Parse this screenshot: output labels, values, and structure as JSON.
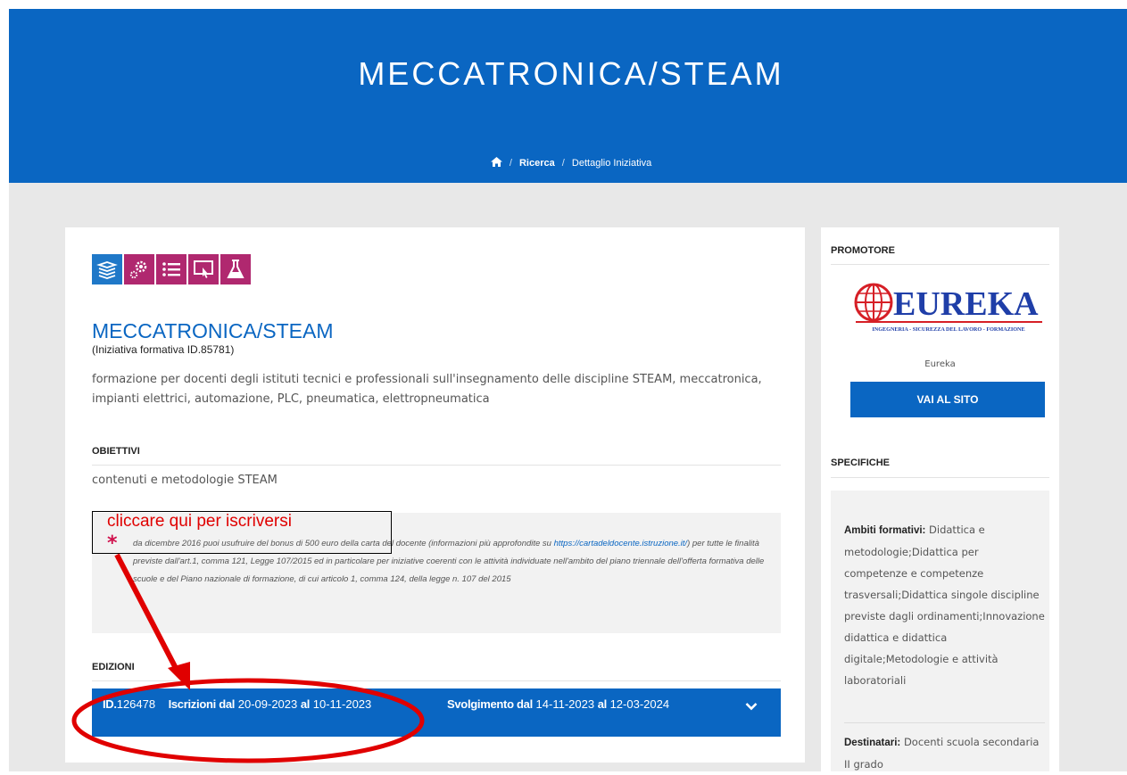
{
  "hero": {
    "title": "MECCATRONICA/STEAM"
  },
  "breadcrumb": {
    "home_icon": "home-icon",
    "separator": "/",
    "items": [
      "Ricerca",
      "Dettaglio Iniziativa"
    ]
  },
  "initiative": {
    "category_icons": [
      {
        "name": "books-icon",
        "color": "#1f78c8"
      },
      {
        "name": "gears-icon",
        "color": "#b0286f"
      },
      {
        "name": "list-icon",
        "color": "#b0286f"
      },
      {
        "name": "touch-screen-icon",
        "color": "#b0286f"
      },
      {
        "name": "flask-icon",
        "color": "#b0286f"
      }
    ],
    "title": "MECCATRONICA/STEAM",
    "subtitle": "(Iniziativa formativa ID.85781)",
    "description": "formazione per docenti degli istituti tecnici e professionali sull'insegnamento delle discipline STEAM, meccatronica, impianti elettrici, automazione, PLC, pneumatica, elettropneumatica",
    "objectives_heading": "OBIETTIVI",
    "objectives": "contenuti e metodologie STEAM",
    "bonus_star": "*",
    "bonus_text_1": "da dicembre 2016 puoi usufruire del bonus di 500 euro della carta del docente (informazioni più approfondite su",
    "bonus_link": "https://cartadeldocente.istruzione.it/",
    "bonus_text_2": ") per tutte le finalità previste dall'art.1, comma 121, Legge 107/2015 ed in particolare per iniziative coerenti con le attività individuate nell'ambito del piano triennale dell'offerta formativa delle scuole e del Piano nazionale di formazione, di cui articolo 1, comma 124, della legge n. 107 del 2015",
    "editions_heading": "EDIZIONI",
    "edition": {
      "id_label": "ID.",
      "id": "126478",
      "enroll_label": "Iscrizioni dal",
      "enroll_from": "20-09-2023",
      "to_label": "al",
      "enroll_to": "10-11-2023",
      "run_label": "Svolgimento dal",
      "run_from": "14-11-2023",
      "run_to": "12-03-2024"
    }
  },
  "sidebar": {
    "promoter_heading": "PROMOTORE",
    "logo_text": "EUREKA",
    "logo_tagline": "INGEGNERIA - SICUREZZA DEL LAVORO - FORMAZIONE",
    "promoter_name": "Eureka",
    "site_button": "VAI AL SITO",
    "specs_heading": "SPECIFICHE",
    "specs": [
      {
        "label": "Ambiti formativi:",
        "value": "Didattica e metodologie;Didattica per competenze e competenze trasversali;Didattica singole discipline previste dagli ordinamenti;Innovazione didattica e didattica digitale;Metodologie e attività laboratoriali"
      },
      {
        "label": "Destinatari:",
        "value": "Docenti scuola secondaria II grado"
      }
    ]
  },
  "annotation": {
    "text": "cliccare qui per iscriversi",
    "color": "#e00000"
  }
}
